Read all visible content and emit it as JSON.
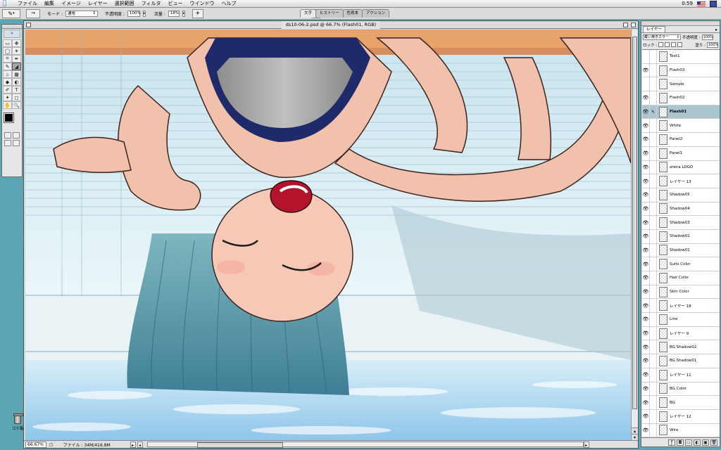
{
  "menubar": {
    "items": [
      "ファイル",
      "編集",
      "イメージ",
      "レイヤー",
      "選択範囲",
      "フィルタ",
      "ビュー",
      "ウインドウ",
      "ヘルプ"
    ],
    "clock": "0:59"
  },
  "optionsbar": {
    "mode_label": "モード :",
    "mode_value": "通常",
    "opacity_label": "不透明度 :",
    "opacity_value": "100%",
    "flow_label": "流量 :",
    "flow_value": "18%",
    "palette_tabs": [
      "文字",
      "ヒストリー",
      "色見本",
      "アクション"
    ]
  },
  "toolbox": {
    "tools": [
      "▭",
      "✥",
      "◯",
      "✶",
      "⌗",
      "✒",
      "✎",
      "◢",
      "♨",
      "▦",
      "◆",
      "◐",
      "✐",
      "T",
      "✦",
      "◻",
      "✋",
      "🔍"
    ]
  },
  "document": {
    "title": "ds10-06-2.psd @ 66.7% (Flash01, RGB)",
    "zoom": "66.67%",
    "doc_size": "ファイル : 34M/416.8M"
  },
  "layers": {
    "tab": "レイヤー",
    "blend_mode": "覆い焼きカラー",
    "opacity_label": "不透明度 :",
    "opacity_value": "100%",
    "lock_label": "ロック :",
    "fill_label": "塗り :",
    "fill_value": "100%",
    "items": [
      {
        "name": "Text1",
        "visible": false,
        "active": false
      },
      {
        "name": "Flash03",
        "visible": true,
        "active": false
      },
      {
        "name": "Sample",
        "visible": false,
        "active": false
      },
      {
        "name": "Flash02",
        "visible": true,
        "active": false
      },
      {
        "name": "Flash01",
        "visible": true,
        "active": true
      },
      {
        "name": "White",
        "visible": true,
        "active": false
      },
      {
        "name": "Panel2",
        "visible": true,
        "active": false
      },
      {
        "name": "Panel1",
        "visible": true,
        "active": false
      },
      {
        "name": "arena LOGO",
        "visible": true,
        "active": false
      },
      {
        "name": "レイヤー 13",
        "visible": true,
        "active": false
      },
      {
        "name": "Shadow05",
        "visible": true,
        "active": false
      },
      {
        "name": "Shadow04",
        "visible": true,
        "active": false
      },
      {
        "name": "Shadow03",
        "visible": true,
        "active": false
      },
      {
        "name": "Shadow02",
        "visible": true,
        "active": false
      },
      {
        "name": "Shadow01",
        "visible": true,
        "active": false
      },
      {
        "name": "Suits Color",
        "visible": true,
        "active": false
      },
      {
        "name": "Hair Color",
        "visible": true,
        "active": false
      },
      {
        "name": "Skin Color",
        "visible": true,
        "active": false
      },
      {
        "name": "レイヤー 18",
        "visible": true,
        "active": false
      },
      {
        "name": "Line",
        "visible": true,
        "active": false
      },
      {
        "name": "レイヤー 9",
        "visible": true,
        "active": false
      },
      {
        "name": "BG Shadow02",
        "visible": true,
        "active": false
      },
      {
        "name": "BG Shadow01",
        "visible": true,
        "active": false
      },
      {
        "name": "レイヤー 11",
        "visible": true,
        "active": false
      },
      {
        "name": "BG Color",
        "visible": true,
        "active": false
      },
      {
        "name": "BG",
        "visible": true,
        "active": false
      },
      {
        "name": "レイヤー 12",
        "visible": true,
        "active": false
      },
      {
        "name": "Wire",
        "visible": true,
        "active": false
      }
    ]
  },
  "desktop": {
    "trash_label": "ゴミ箱"
  }
}
